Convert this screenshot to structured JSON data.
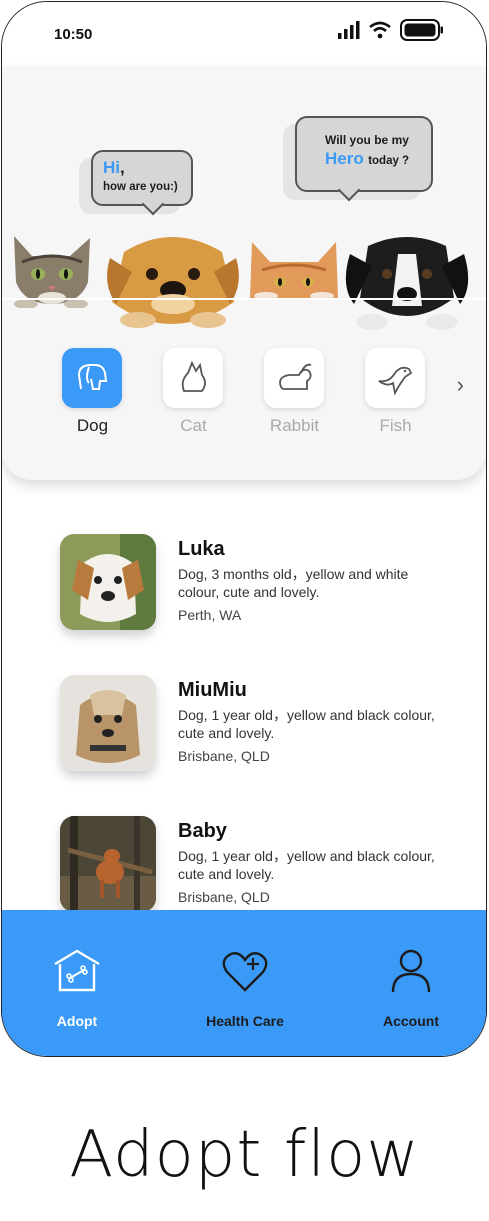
{
  "status": {
    "time": "10:50"
  },
  "hero": {
    "bubble1": {
      "line1_hi": "Hi",
      "line1_rest": ",",
      "line2": "how are you:)"
    },
    "bubble2": {
      "line1": "Will you be my",
      "hero": "Hero",
      "rest": "today ?"
    }
  },
  "categories": [
    {
      "label": "Dog",
      "icon": "dog-icon",
      "active": true
    },
    {
      "label": "Cat",
      "icon": "cat-icon",
      "active": false
    },
    {
      "label": "Rabbit",
      "icon": "rabbit-icon",
      "active": false
    },
    {
      "label": "Fish",
      "icon": "fish-icon",
      "active": false
    }
  ],
  "pets": [
    {
      "name": "Luka",
      "desc": "Dog, 3 months old，yellow and white colour, cute and lovely.",
      "location": "Perth, WA"
    },
    {
      "name": "MiuMiu",
      "desc": "Dog, 1 year old，yellow and black colour, cute and lovely.",
      "location": "Brisbane, QLD"
    },
    {
      "name": "Baby",
      "desc": "Dog, 1 year old，yellow and black colour, cute and lovely.",
      "location": "Brisbane, QLD"
    }
  ],
  "tabs": [
    {
      "label": "Adopt",
      "icon": "house-bone-icon",
      "active": true
    },
    {
      "label": "Health Care",
      "icon": "heart-plus-icon",
      "active": false
    },
    {
      "label": "Account",
      "icon": "person-icon",
      "active": false
    }
  ],
  "colors": {
    "accent": "#3b9af7",
    "tab_active_text": "#ffffff",
    "tab_inactive_text": "#1c1c1c"
  },
  "caption": "Adopt flow"
}
